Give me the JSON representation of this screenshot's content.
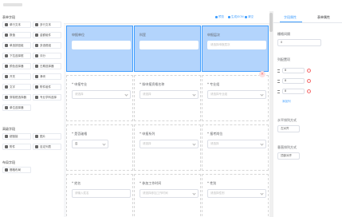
{
  "left_panel": {
    "groups": [
      {
        "title": "表单字段",
        "items": [
          "单行文本",
          "多行文本",
          "数值",
          "金额组件",
          "单选按钮组",
          "多选框组",
          "下拉选择框",
          "评分",
          "颜色选择器",
          "日期选择器",
          "开关",
          "滑块",
          "文字",
          "附件组件",
          "穿梭框选择器",
          "专业学科选择",
          "单位选择器"
        ]
      },
      {
        "title": "高级字段",
        "items": [
          "超链接",
          "图片",
          "附件",
          "自定列表"
        ]
      },
      {
        "title": "布局字段",
        "items": [
          "栅格布局"
        ]
      }
    ]
  },
  "toolbar": {
    "preview": "预览",
    "gen_json": "生成JSON",
    "clear": "清空"
  },
  "canvas": {
    "rows": [
      [
        {
          "label": "申报单位",
          "placeholder": "",
          "selected": true
        },
        {
          "label": "科室",
          "placeholder": "",
          "selected": true
        },
        {
          "label": "申报层次",
          "placeholder": "请选择申报层次",
          "selected": true
        }
      ],
      [
        {
          "label": "申报专业",
          "placeholder": "请选择"
        },
        {
          "label": "拟申报资格名称",
          "placeholder": "请选择"
        },
        {
          "label": "专业组",
          "placeholder": "请选择专业组"
        }
      ],
      [
        {
          "label": "是否破格",
          "placeholder": "否",
          "value": true
        },
        {
          "label": "申报系列",
          "placeholder": "请选择"
        },
        {
          "label": "报考岗位",
          "placeholder": "请选择"
        }
      ],
      [
        {
          "label": "姓名",
          "placeholder": "请输入姓名"
        },
        {
          "label": "参加工作时间",
          "placeholder": "请选择参加工作时间"
        },
        {
          "label": "性别",
          "placeholder": "请选择性别"
        }
      ]
    ]
  },
  "right_panel": {
    "tabs": [
      "字段属性",
      "表单属性"
    ],
    "active_tab": "字段属性",
    "width_label": "栅格间隔",
    "width_value": "0",
    "options_label": "列配置项",
    "options": [
      "8",
      "8",
      "8"
    ],
    "add_option": "添加列",
    "justify_label": "水平排列方式",
    "justify_value": "左对齐",
    "align_label": "垂直排列方式",
    "align_value": "顶部对齐"
  },
  "colors": {
    "accent": "#409eff",
    "selected_bg": "#b3d4fc",
    "danger": "#f56c6c"
  }
}
